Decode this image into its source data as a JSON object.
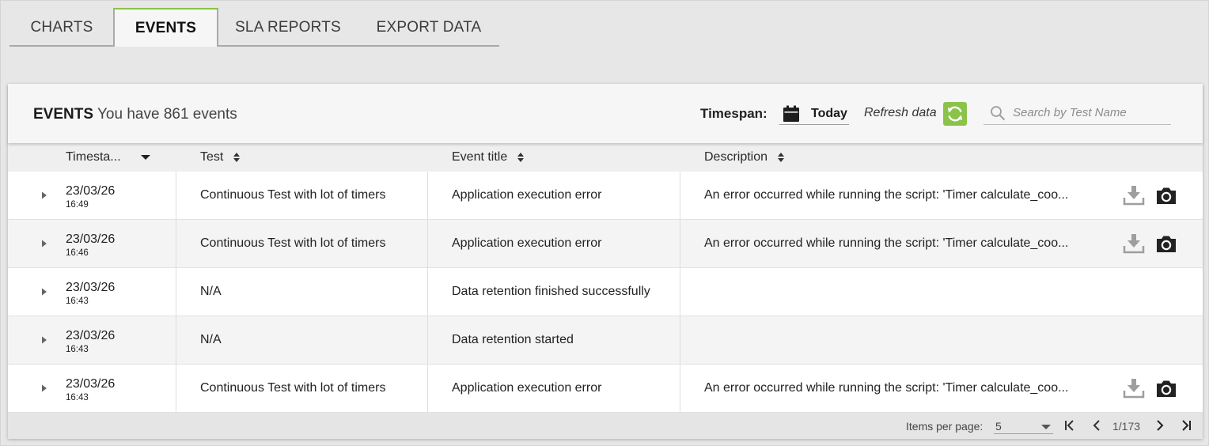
{
  "tabs": [
    {
      "label": "CHARTS",
      "active": false
    },
    {
      "label": "EVENTS",
      "active": true
    },
    {
      "label": "SLA REPORTS",
      "active": false
    },
    {
      "label": "EXPORT DATA",
      "active": false
    }
  ],
  "header": {
    "title": "EVENTS",
    "subtitle": "You have 861 events",
    "timespan_label": "Timespan:",
    "timespan_value": "Today",
    "refresh_label": "Refresh data",
    "search_placeholder": "Search by Test Name"
  },
  "columns": {
    "timestamp": "Timesta...",
    "test": "Test",
    "event_title": "Event title",
    "description": "Description"
  },
  "rows": [
    {
      "date": "23/03/26",
      "time": "16:49",
      "test": "Continuous Test with lot of timers",
      "title": "Application execution error",
      "description": "An error occurred while running the script: 'Timer calculate_coo...",
      "has_actions": true
    },
    {
      "date": "23/03/26",
      "time": "16:46",
      "test": "Continuous Test with lot of timers",
      "title": "Application execution error",
      "description": "An error occurred while running the script: 'Timer calculate_coo...",
      "has_actions": true
    },
    {
      "date": "23/03/26",
      "time": "16:43",
      "test": "N/A",
      "title": "Data retention finished successfully",
      "description": "",
      "has_actions": false
    },
    {
      "date": "23/03/26",
      "time": "16:43",
      "test": "N/A",
      "title": "Data retention started",
      "description": "",
      "has_actions": false
    },
    {
      "date": "23/03/26",
      "time": "16:43",
      "test": "Continuous Test with lot of timers",
      "title": "Application execution error",
      "description": "An error occurred while running the script: 'Timer calculate_coo...",
      "has_actions": true
    }
  ],
  "pagination": {
    "items_per_page_label": "Items per page:",
    "items_per_page": "5",
    "page_info": "1/173"
  },
  "colors": {
    "accent": "#8bc34a",
    "icon_gray": "#9e9e9e",
    "icon_dark": "#212121"
  }
}
